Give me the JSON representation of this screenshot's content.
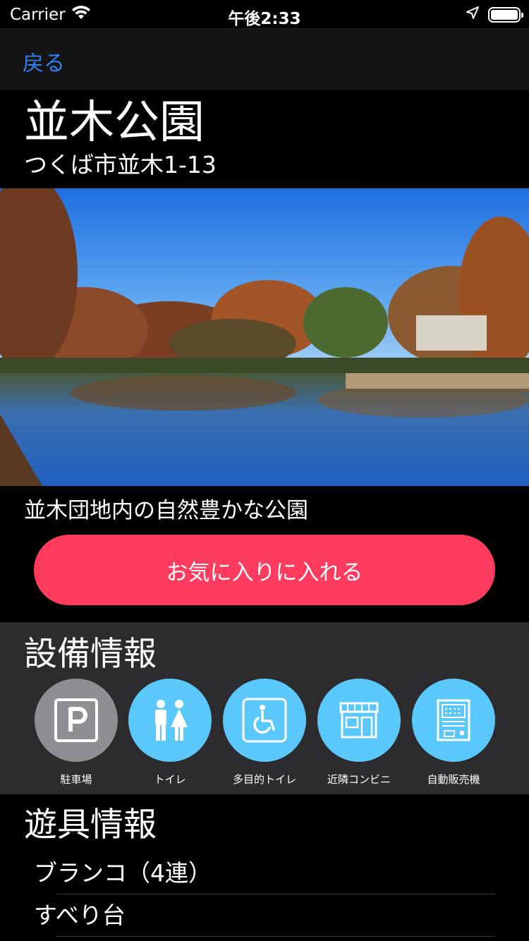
{
  "status_bar": {
    "carrier": "Carrier",
    "time": "午後2:33"
  },
  "nav": {
    "back_label": "戻る"
  },
  "park": {
    "name": "並木公園",
    "address": "つくば市並木1-13",
    "description": "並木団地内の自然豊かな公園"
  },
  "actions": {
    "favorite_label": "お気に入りに入れる"
  },
  "facilities": {
    "title": "設備情報",
    "items": [
      {
        "label": "駐車場",
        "icon": "parking-icon",
        "available": false
      },
      {
        "label": "トイレ",
        "icon": "restroom-icon",
        "available": true
      },
      {
        "label": "多目的トイレ",
        "icon": "accessible-restroom-icon",
        "available": true
      },
      {
        "label": "近隣コンビニ",
        "icon": "convenience-store-icon",
        "available": true
      },
      {
        "label": "自動販売機",
        "icon": "vending-machine-icon",
        "available": true
      }
    ]
  },
  "equipment": {
    "title": "遊具情報",
    "items": [
      "ブランコ（4連）",
      "すべり台"
    ]
  },
  "colors": {
    "accent": "#2f7ff5",
    "favorite": "#ff3b5f",
    "facility_on": "#5ac8fa",
    "facility_off": "#8e8e93"
  }
}
